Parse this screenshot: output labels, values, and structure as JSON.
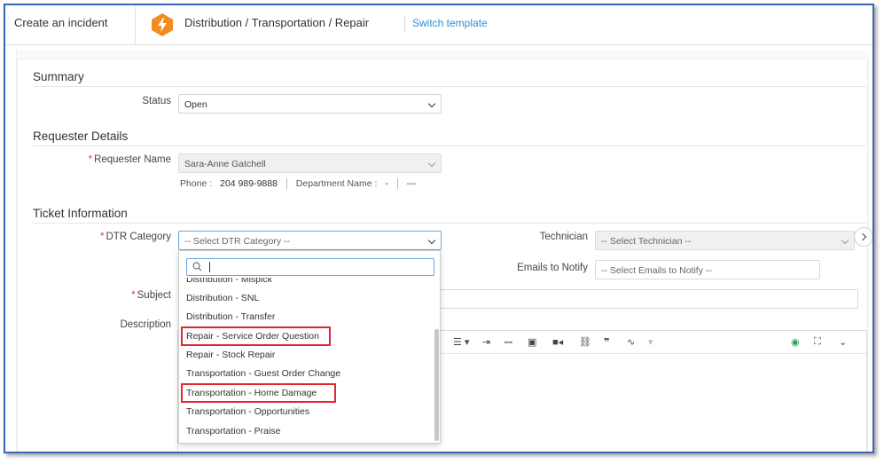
{
  "header": {
    "create_label": "Create an incident",
    "template_path": "Distribution / Transportation / Repair",
    "switch_template": "Switch template"
  },
  "summary": {
    "title": "Summary",
    "status_label": "Status",
    "status_value": "Open"
  },
  "requester": {
    "title": "Requester Details",
    "name_label": "Requester Name",
    "name_value": "Sara-Anne Gatchell",
    "phone_label": "Phone :",
    "phone_value": "204 989-9888",
    "department_label": "Department Name :",
    "department_value": "-",
    "extra_value": "---"
  },
  "ticket": {
    "title": "Ticket Information",
    "dtr_label": "DTR Category",
    "dtr_placeholder": "-- Select DTR Category --",
    "technician_label": "Technician",
    "technician_placeholder": "-- Select Technician --",
    "emails_label": "Emails to Notify",
    "emails_placeholder": "-- Select Emails to Notify --",
    "subject_label": "Subject",
    "description_label": "Description"
  },
  "dropdown": {
    "items": [
      "Distribution - Mispick",
      "Distribution - SNL",
      "Distribution - Transfer",
      "Repair - Service Order Question",
      "Repair - Stock Repair",
      "Transportation - Guest Order Change",
      "Transportation - Home Damage",
      "Transportation - Opportunities",
      "Transportation - Praise"
    ],
    "highlight_color": "#e0262e"
  },
  "colors": {
    "accent": "#2f8fd8",
    "frame": "#3b66b5",
    "required": "#e23b3b",
    "logo": "#f28c1e"
  }
}
